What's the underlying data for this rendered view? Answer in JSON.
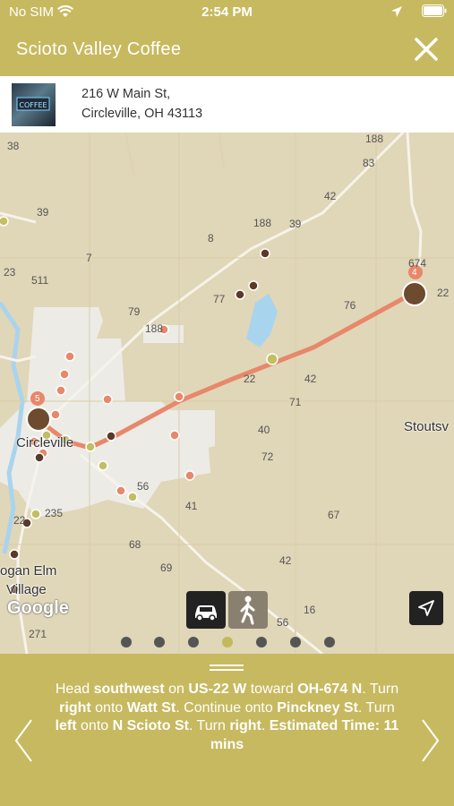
{
  "status": {
    "carrier": "No SIM",
    "time": "2:54 PM"
  },
  "header": {
    "title": "Scioto Valley Coffee"
  },
  "location": {
    "address_line1": "216 W Main St,",
    "address_line2": "Circleville, OH 43113"
  },
  "map": {
    "road_labels": [
      "38",
      "188",
      "83",
      "42",
      "39",
      "188",
      "39",
      "8",
      "7",
      "23",
      "511",
      "79",
      "77",
      "76",
      "674",
      "22",
      "188",
      "22",
      "42",
      "71",
      "40",
      "72",
      "41",
      "235",
      "22",
      "56",
      "67",
      "68",
      "69",
      "42",
      "16",
      "56",
      "271"
    ],
    "town_labels": [
      "Circleville",
      "Stoutsv",
      "ogan Elm",
      "Village"
    ],
    "markers": [
      "5",
      "4"
    ],
    "attribution": "Google",
    "route_color": "#e8876a",
    "water_color": "#a9d4ee"
  },
  "modes": {
    "driving": "car-icon",
    "walking": "walk-icon",
    "active": "driving"
  },
  "pager": {
    "count": 7,
    "active_index": 3
  },
  "directions": {
    "segments": [
      {
        "t": "Head ",
        "b": false
      },
      {
        "t": "southwest",
        "b": true
      },
      {
        "t": " on ",
        "b": false
      },
      {
        "t": "US-22 W",
        "b": true
      },
      {
        "t": " toward ",
        "b": false
      },
      {
        "t": "OH-674 N",
        "b": true
      },
      {
        "t": ". Turn ",
        "b": false
      },
      {
        "t": "right",
        "b": true
      },
      {
        "t": " onto ",
        "b": false
      },
      {
        "t": "Watt St",
        "b": true
      },
      {
        "t": ". Continue onto ",
        "b": false
      },
      {
        "t": "Pinckney St",
        "b": true
      },
      {
        "t": ". Turn ",
        "b": false
      },
      {
        "t": "left",
        "b": true
      },
      {
        "t": " onto ",
        "b": false
      },
      {
        "t": "N Scioto St",
        "b": true
      },
      {
        "t": ". Turn ",
        "b": false
      },
      {
        "t": "right",
        "b": true
      },
      {
        "t": ". ",
        "b": false
      }
    ],
    "estimated_time": "Estimated Time: 11 mins"
  },
  "colors": {
    "accent": "#c7b95f",
    "marker": "#6e4a2e",
    "stop_dot": "#e8876a",
    "green_dot": "#c2be62"
  }
}
